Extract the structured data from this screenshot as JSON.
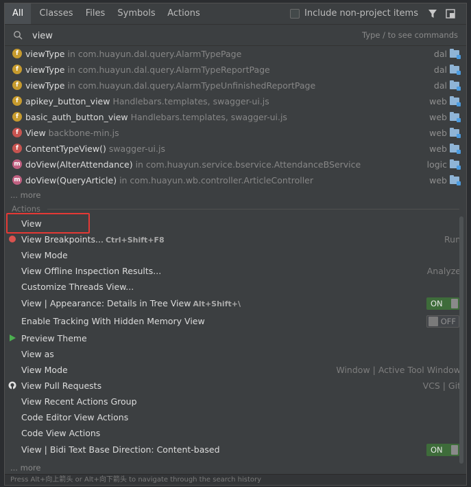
{
  "tabs": [
    {
      "label": "All",
      "active": true
    },
    {
      "label": "Classes"
    },
    {
      "label": "Files"
    },
    {
      "label": "Symbols"
    },
    {
      "label": "Actions"
    }
  ],
  "include_label": "Include non-project items",
  "search": {
    "value": "view",
    "hint": "Type / to see commands"
  },
  "results": [
    {
      "icon": "f",
      "kind": "field",
      "name": "viewType",
      "loc": " in com.huayun.dal.query.AlarmTypePage",
      "module": "dal"
    },
    {
      "icon": "f",
      "kind": "field",
      "name": "viewType",
      "loc": " in com.huayun.dal.query.AlarmTypeReportPage",
      "module": "dal"
    },
    {
      "icon": "f",
      "kind": "field",
      "name": "viewType",
      "loc": " in com.huayun.dal.query.AlarmTypeUnfinishedReportPage",
      "module": "dal"
    },
    {
      "icon": "f",
      "kind": "field",
      "name": "apikey_button_view",
      "loc": " Handlebars.templates, swagger-ui.js",
      "module": "web"
    },
    {
      "icon": "f",
      "kind": "field",
      "name": "basic_auth_button_view",
      "loc": " Handlebars.templates, swagger-ui.js",
      "module": "web"
    },
    {
      "icon": "f",
      "kind": "func",
      "name": "View",
      "loc": " backbone-min.js",
      "module": "web"
    },
    {
      "icon": "f",
      "kind": "func",
      "name": "ContentTypeView()",
      "loc": " swagger-ui.js",
      "module": "web"
    },
    {
      "icon": "m",
      "kind": "method",
      "name": "doView(AlterAttendance)",
      "loc": " in com.huayun.service.bservice.AttendanceBService",
      "module": "logic"
    },
    {
      "icon": "m",
      "kind": "method",
      "name": "doView(QueryArticle)",
      "loc": " in com.huayun.wb.controller.ArticleController",
      "module": "web"
    }
  ],
  "more_label": "... more",
  "actions_section": "Actions",
  "actions": [
    {
      "label": "View",
      "shortcut": "",
      "group": ""
    },
    {
      "label": "View Breakpoints...",
      "shortcut": "Ctrl+Shift+F8",
      "group": "Run",
      "icon": "breakpoint"
    },
    {
      "label": "View Mode",
      "shortcut": "",
      "group": ""
    },
    {
      "label": "View Offline Inspection Results...",
      "shortcut": "",
      "group": "Analyze"
    },
    {
      "label": "Customize Threads View...",
      "shortcut": "",
      "group": ""
    },
    {
      "label": "View | Appearance: Details in Tree View",
      "shortcut": "Alt+Shift+\\",
      "toggle": "ON"
    },
    {
      "label": "Enable Tracking With Hidden Memory View",
      "shortcut": "",
      "toggle": "OFF"
    },
    {
      "label": "Preview Theme",
      "shortcut": "",
      "group": "",
      "icon": "play"
    },
    {
      "label": "View as",
      "shortcut": "",
      "group": ""
    },
    {
      "label": "View Mode",
      "shortcut": "",
      "group": "Window | Active Tool Window"
    },
    {
      "label": "View Pull Requests",
      "shortcut": "",
      "group": "VCS | Git",
      "icon": "github"
    },
    {
      "label": "View Recent Actions Group",
      "shortcut": "",
      "group": ""
    },
    {
      "label": "Code Editor View Actions",
      "shortcut": "",
      "group": ""
    },
    {
      "label": "Code View Actions",
      "shortcut": "",
      "group": ""
    },
    {
      "label": "View | Bidi Text Base Direction: Content-based",
      "shortcut": "",
      "toggle": "ON"
    }
  ],
  "footer": "Press Alt+向上箭头 or Alt+向下箭头 to navigate through the search history",
  "colors": {
    "accent_highlight": "#e53935",
    "toggle_on": "#3e6c3a"
  }
}
